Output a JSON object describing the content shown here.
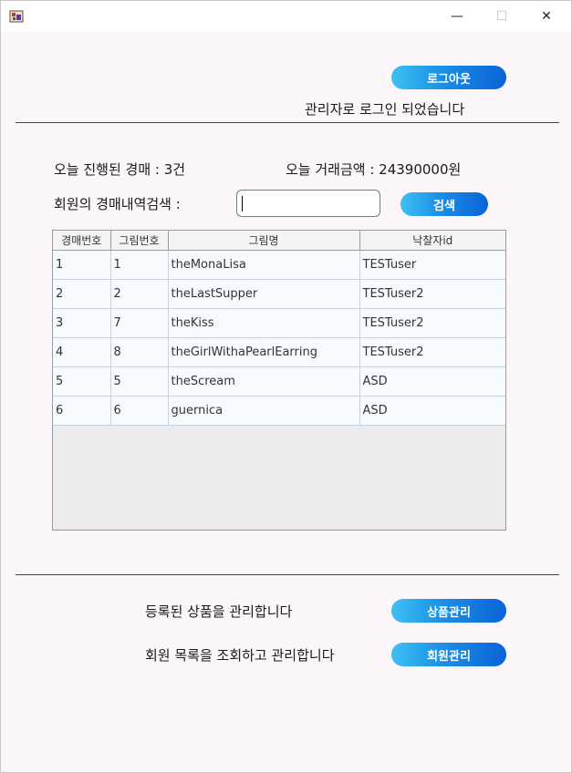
{
  "window": {
    "minimize": "—",
    "maximize": "☐",
    "close": "✕"
  },
  "header": {
    "logout_button": "로그아웃",
    "status_text": "관리자로 로그인 되었습니다"
  },
  "stats": {
    "auction_count_text": "오늘 진행된 경매 : 3건",
    "trade_amount_text": "오늘 거래금액 : 24390000원"
  },
  "search": {
    "label": "회원의 경매내역검색 :",
    "value": "",
    "button": "검색"
  },
  "table": {
    "columns": [
      "경매번호",
      "그림번호",
      "그림명",
      "낙찰자id"
    ],
    "rows": [
      [
        "1",
        "1",
        "theMonaLisa",
        "TESTuser"
      ],
      [
        "2",
        "2",
        "theLastSupper",
        "TESTuser2"
      ],
      [
        "3",
        "7",
        "theKiss",
        "TESTuser2"
      ],
      [
        "4",
        "8",
        "theGirlWithaPearlEarring",
        "TESTuser2"
      ],
      [
        "5",
        "5",
        "theScream",
        "ASD"
      ],
      [
        "6",
        "6",
        "guernica",
        "ASD"
      ]
    ]
  },
  "manage": {
    "product_text": "등록된 상품을 관리합니다",
    "product_button": "상품관리",
    "member_text": "회원 목록을 조회하고 관리합니다",
    "member_button": "회원관리"
  },
  "colors": {
    "button_start": "#3fc0f3",
    "button_end": "#0b63d6",
    "background": "#fbf6fa"
  }
}
